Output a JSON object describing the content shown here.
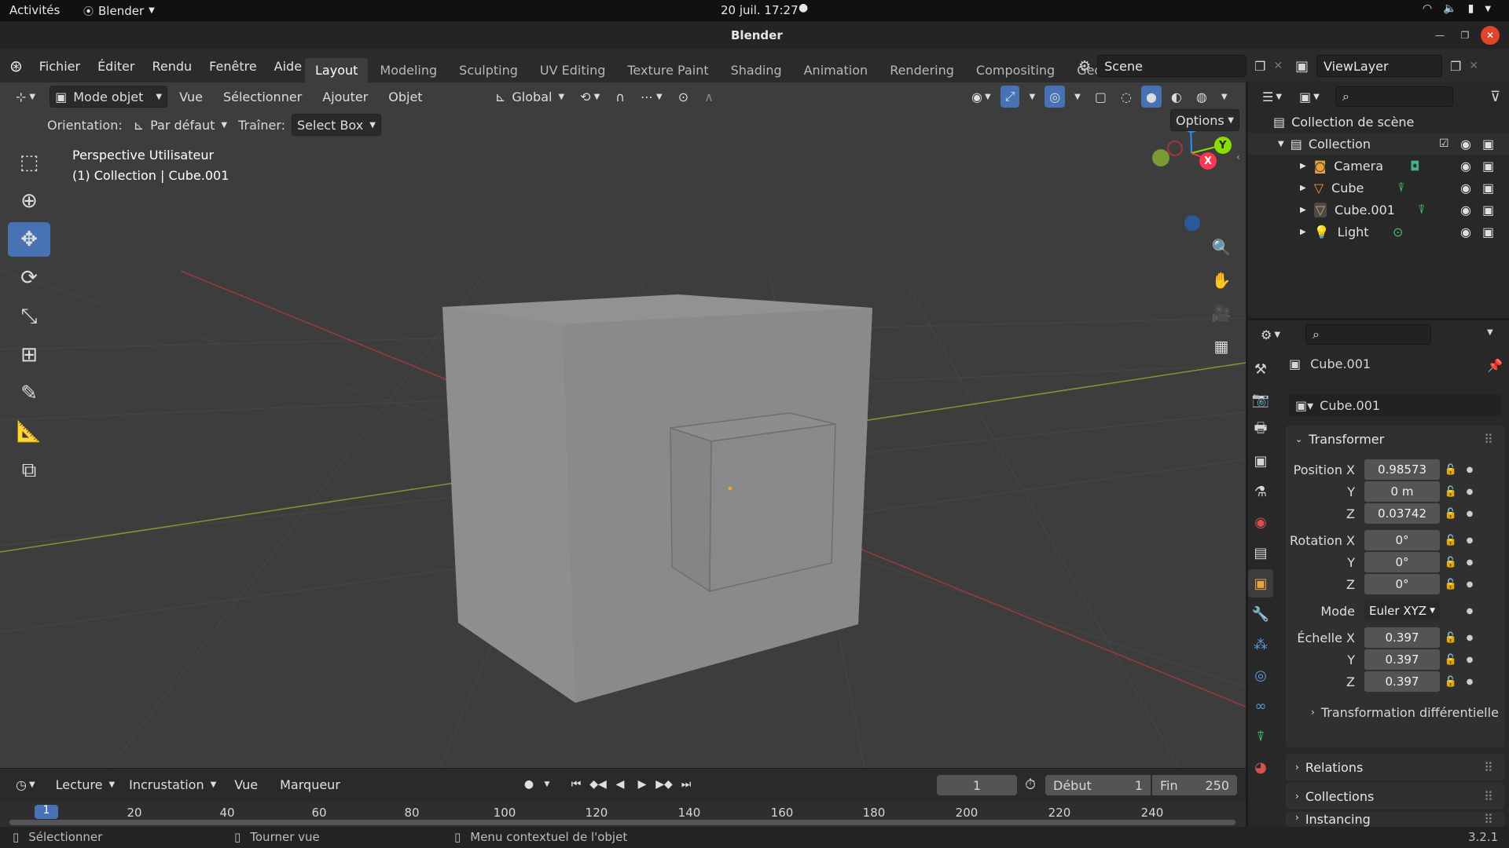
{
  "system_bar": {
    "activities": "Activités",
    "app_menu": "Blender",
    "datetime": "20 juil.  17:27"
  },
  "window": {
    "title": "Blender"
  },
  "menus": [
    "Fichier",
    "Éditer",
    "Rendu",
    "Fenêtre",
    "Aide"
  ],
  "workspaces": {
    "active": "Layout",
    "tabs": [
      "Layout",
      "Modeling",
      "Sculpting",
      "UV Editing",
      "Texture Paint",
      "Shading",
      "Animation",
      "Rendering",
      "Compositing",
      "Geomet"
    ]
  },
  "scene": {
    "name": "Scene"
  },
  "view_layer": {
    "name": "ViewLayer"
  },
  "viewport_header": {
    "mode": "Mode objet",
    "menus": [
      "Vue",
      "Sélectionner",
      "Ajouter",
      "Objet"
    ],
    "transform_orientation": "Global"
  },
  "tool_settings": {
    "orientation_label": "Orientation:",
    "orientation_value": "Par défaut",
    "drag_label": "Traîner:",
    "drag_value": "Select Box",
    "options": "Options"
  },
  "viewport": {
    "view_name": "Perspective Utilisateur",
    "context": "(1) Collection | Cube.001"
  },
  "gizmo": {
    "x": "X",
    "y": "Y",
    "z": "Z"
  },
  "outliner": {
    "scene_collection": "Collection de scène",
    "collection": "Collection",
    "items": [
      {
        "name": "Camera",
        "icon": "camera-icon",
        "data_icon": "camera-data-icon"
      },
      {
        "name": "Cube",
        "icon": "mesh-icon",
        "data_icon": "mesh-data-icon"
      },
      {
        "name": "Cube.001",
        "icon": "mesh-icon",
        "data_icon": "mesh-data-icon"
      },
      {
        "name": "Light",
        "icon": "light-icon",
        "data_icon": "light-data-icon"
      }
    ]
  },
  "properties": {
    "object_name": "Cube.001",
    "datablock_name": "Cube.001",
    "transform_panel": "Transformer",
    "position": {
      "label": "Position X",
      "x": "0.98573",
      "y": "0 m",
      "z": "0.03742"
    },
    "rotation": {
      "label": "Rotation X",
      "x": "0°",
      "y": "0°",
      "z": "0°"
    },
    "mode": {
      "label": "Mode",
      "value": "Euler XYZ"
    },
    "scale": {
      "label": "Échelle X",
      "x": "0.397",
      "y": "0.397",
      "z": "0.397"
    },
    "axis_y": "Y",
    "axis_z": "Z",
    "delta_transform": "Transformation différentielle",
    "panels": [
      "Relations",
      "Collections",
      "Instancing"
    ]
  },
  "timeline": {
    "menus": [
      "Lecture",
      "Incrustation",
      "Vue",
      "Marqueur"
    ],
    "current_frame": "1",
    "start_label": "Début",
    "start": "1",
    "end_label": "Fin",
    "end": "250",
    "ticks": [
      "1",
      "20",
      "40",
      "60",
      "80",
      "100",
      "120",
      "140",
      "160",
      "180",
      "200",
      "220",
      "240"
    ]
  },
  "statusbar": {
    "select": "Sélectionner",
    "rotate": "Tourner vue",
    "context_menu": "Menu contextuel de l'objet",
    "version": "3.2.1"
  },
  "colors": {
    "accent": "#4772b3",
    "x_axis": "#ff3352",
    "y_axis": "#8bdc00",
    "z_axis": "#2890ff",
    "viewport_bg": "#3d3d3d",
    "mesh_orange": "#e8a040"
  }
}
